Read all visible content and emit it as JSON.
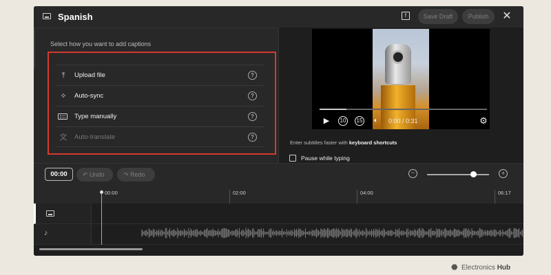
{
  "header": {
    "title": "Spanish",
    "save_draft": "Save Draft",
    "publish": "Publish",
    "close": "✕"
  },
  "left_panel": {
    "prompt": "Select how you want to add captions",
    "options": [
      {
        "label": "Upload file",
        "icon": "upload-icon",
        "glyph": "⤒",
        "enabled": true
      },
      {
        "label": "Auto-sync",
        "icon": "sparkle-icon",
        "glyph": "✧",
        "enabled": true
      },
      {
        "label": "Type manually",
        "icon": "keyboard-icon",
        "glyph": "",
        "enabled": true
      },
      {
        "label": "Auto-translate",
        "icon": "translate-icon",
        "glyph": "文",
        "enabled": false
      }
    ],
    "help_glyph": "?"
  },
  "player": {
    "time": "0:00 / 0:31",
    "progress": 0.16,
    "rewind_label": "10",
    "forward_label": "15"
  },
  "editor": {
    "hint_prefix": "Enter subtitles faster with ",
    "hint_link": "keyboard shortcuts",
    "pause_label": "Pause while typing"
  },
  "toolbar": {
    "timecode": "00:00",
    "undo": "Undo",
    "redo": "Redo",
    "zoom_level": 0.75
  },
  "timeline": {
    "ticks": [
      "00:00",
      "02:00",
      "04:00",
      "06:17"
    ]
  },
  "branding": {
    "prefix": "Electronics",
    "suffix": "Hub"
  },
  "colors": {
    "highlight_box": "#d63a2f",
    "window_bg": "#282828",
    "page_bg": "#ece8df"
  }
}
